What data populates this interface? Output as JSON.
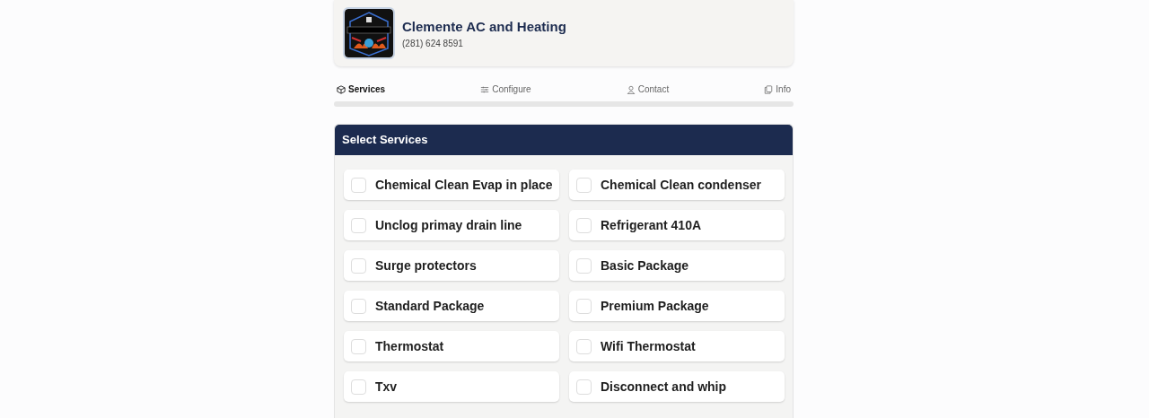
{
  "business": {
    "name": "Clemente AC and Heating",
    "phone": "(281) 624 8591"
  },
  "tabs": [
    {
      "label": "Services",
      "kind": "box",
      "selected": true
    },
    {
      "label": "Configure",
      "kind": "sliders",
      "selected": false
    },
    {
      "label": "Contact",
      "kind": "user",
      "selected": false
    },
    {
      "label": "Info",
      "kind": "copy",
      "selected": false
    }
  ],
  "panel": {
    "title": "Select Services"
  },
  "services": [
    {
      "label": "Chemical Clean Evap in place",
      "checked": false
    },
    {
      "label": "Chemical Clean condenser",
      "checked": false
    },
    {
      "label": "Unclog primay drain line",
      "checked": false
    },
    {
      "label": "Refrigerant 410A",
      "checked": false
    },
    {
      "label": "Surge protectors",
      "checked": false
    },
    {
      "label": "Basic Package",
      "checked": false
    },
    {
      "label": "Standard Package",
      "checked": false
    },
    {
      "label": "Premium Package",
      "checked": false
    },
    {
      "label": "Thermostat",
      "checked": false
    },
    {
      "label": "Wifi Thermostat",
      "checked": false
    },
    {
      "label": "Txv",
      "checked": false
    },
    {
      "label": "Disconnect and whip",
      "checked": false
    }
  ]
}
